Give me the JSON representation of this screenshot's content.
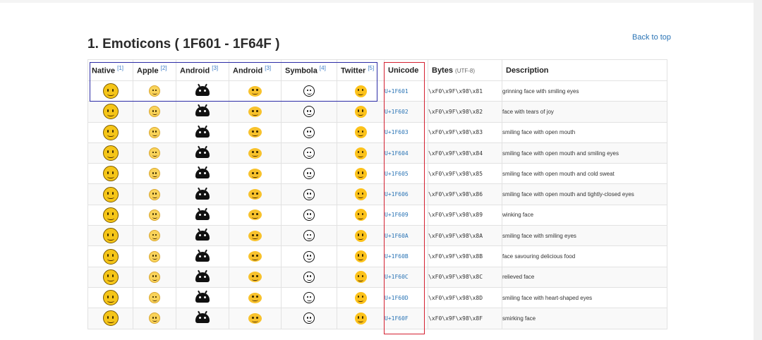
{
  "section_title": "1. Emoticons ( 1F601 - 1F64F )",
  "back_to_top": "Back to top",
  "headers": {
    "native": "Native",
    "native_ref": "[1]",
    "apple": "Apple",
    "apple_ref": "[2]",
    "android1": "Android",
    "android1_ref": "[3]",
    "android2": "Android",
    "android2_ref": "[3]",
    "symbola": "Symbola",
    "symbola_ref": "[4]",
    "twitter": "Twitter",
    "twitter_ref": "[5]",
    "unicode": "Unicode",
    "bytes": "Bytes",
    "bytes_sub": "(UTF-8)",
    "description": "Description"
  },
  "rows": [
    {
      "unicode": "U+1F601",
      "bytes": "\\xF0\\x9F\\x98\\x81",
      "description": "grinning face with smiling eyes"
    },
    {
      "unicode": "U+1F602",
      "bytes": "\\xF0\\x9F\\x98\\x82",
      "description": "face with tears of joy"
    },
    {
      "unicode": "U+1F603",
      "bytes": "\\xF0\\x9F\\x98\\x83",
      "description": "smiling face with open mouth"
    },
    {
      "unicode": "U+1F604",
      "bytes": "\\xF0\\x9F\\x98\\x84",
      "description": "smiling face with open mouth and smiling eyes"
    },
    {
      "unicode": "U+1F605",
      "bytes": "\\xF0\\x9F\\x98\\x85",
      "description": "smiling face with open mouth and cold sweat"
    },
    {
      "unicode": "U+1F606",
      "bytes": "\\xF0\\x9F\\x98\\x86",
      "description": "smiling face with open mouth and tightly-closed eyes"
    },
    {
      "unicode": "U+1F609",
      "bytes": "\\xF0\\x9F\\x98\\x89",
      "description": "winking face"
    },
    {
      "unicode": "U+1F60A",
      "bytes": "\\xF0\\x9F\\x98\\x8A",
      "description": "smiling face with smiling eyes"
    },
    {
      "unicode": "U+1F60B",
      "bytes": "\\xF0\\x9F\\x98\\x8B",
      "description": "face savouring delicious food"
    },
    {
      "unicode": "U+1F60C",
      "bytes": "\\xF0\\x9F\\x98\\x8C",
      "description": "relieved face"
    },
    {
      "unicode": "U+1F60D",
      "bytes": "\\xF0\\x9F\\x98\\x8D",
      "description": "smiling face with heart-shaped eyes"
    },
    {
      "unicode": "U+1F60F",
      "bytes": "\\xF0\\x9F\\x98\\x8F",
      "description": "smirking face"
    }
  ]
}
